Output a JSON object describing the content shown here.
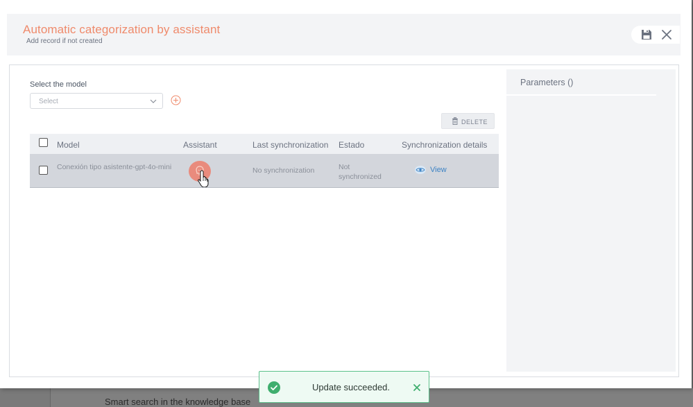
{
  "background": {
    "partial_text": "Smart search in the knowledge base"
  },
  "modal": {
    "title": "Automatic categorization by assistant",
    "subtitle": "Add record if not created",
    "save_icon": "save-icon",
    "close_icon": "close-icon"
  },
  "model_select": {
    "label": "Select the model",
    "placeholder": "Select"
  },
  "toolbar": {
    "delete_label": "DELETE"
  },
  "table": {
    "columns": [
      "Model",
      "Assistant",
      "Last synchronization",
      "Estado",
      "Synchronization details"
    ],
    "rows": [
      {
        "model": "Conexión tipo asistente-gpt-4o-mini",
        "assistant_icon": "assistant-icon",
        "last_sync": "No synchronization",
        "estado": "Not synchronized",
        "details": "View"
      }
    ]
  },
  "params": {
    "title": "Parameters ()"
  },
  "toast": {
    "message": "Update succeeded."
  },
  "colors": {
    "accent": "#ef8a6b",
    "link": "#3b82c4",
    "success": "#5bc08a"
  }
}
